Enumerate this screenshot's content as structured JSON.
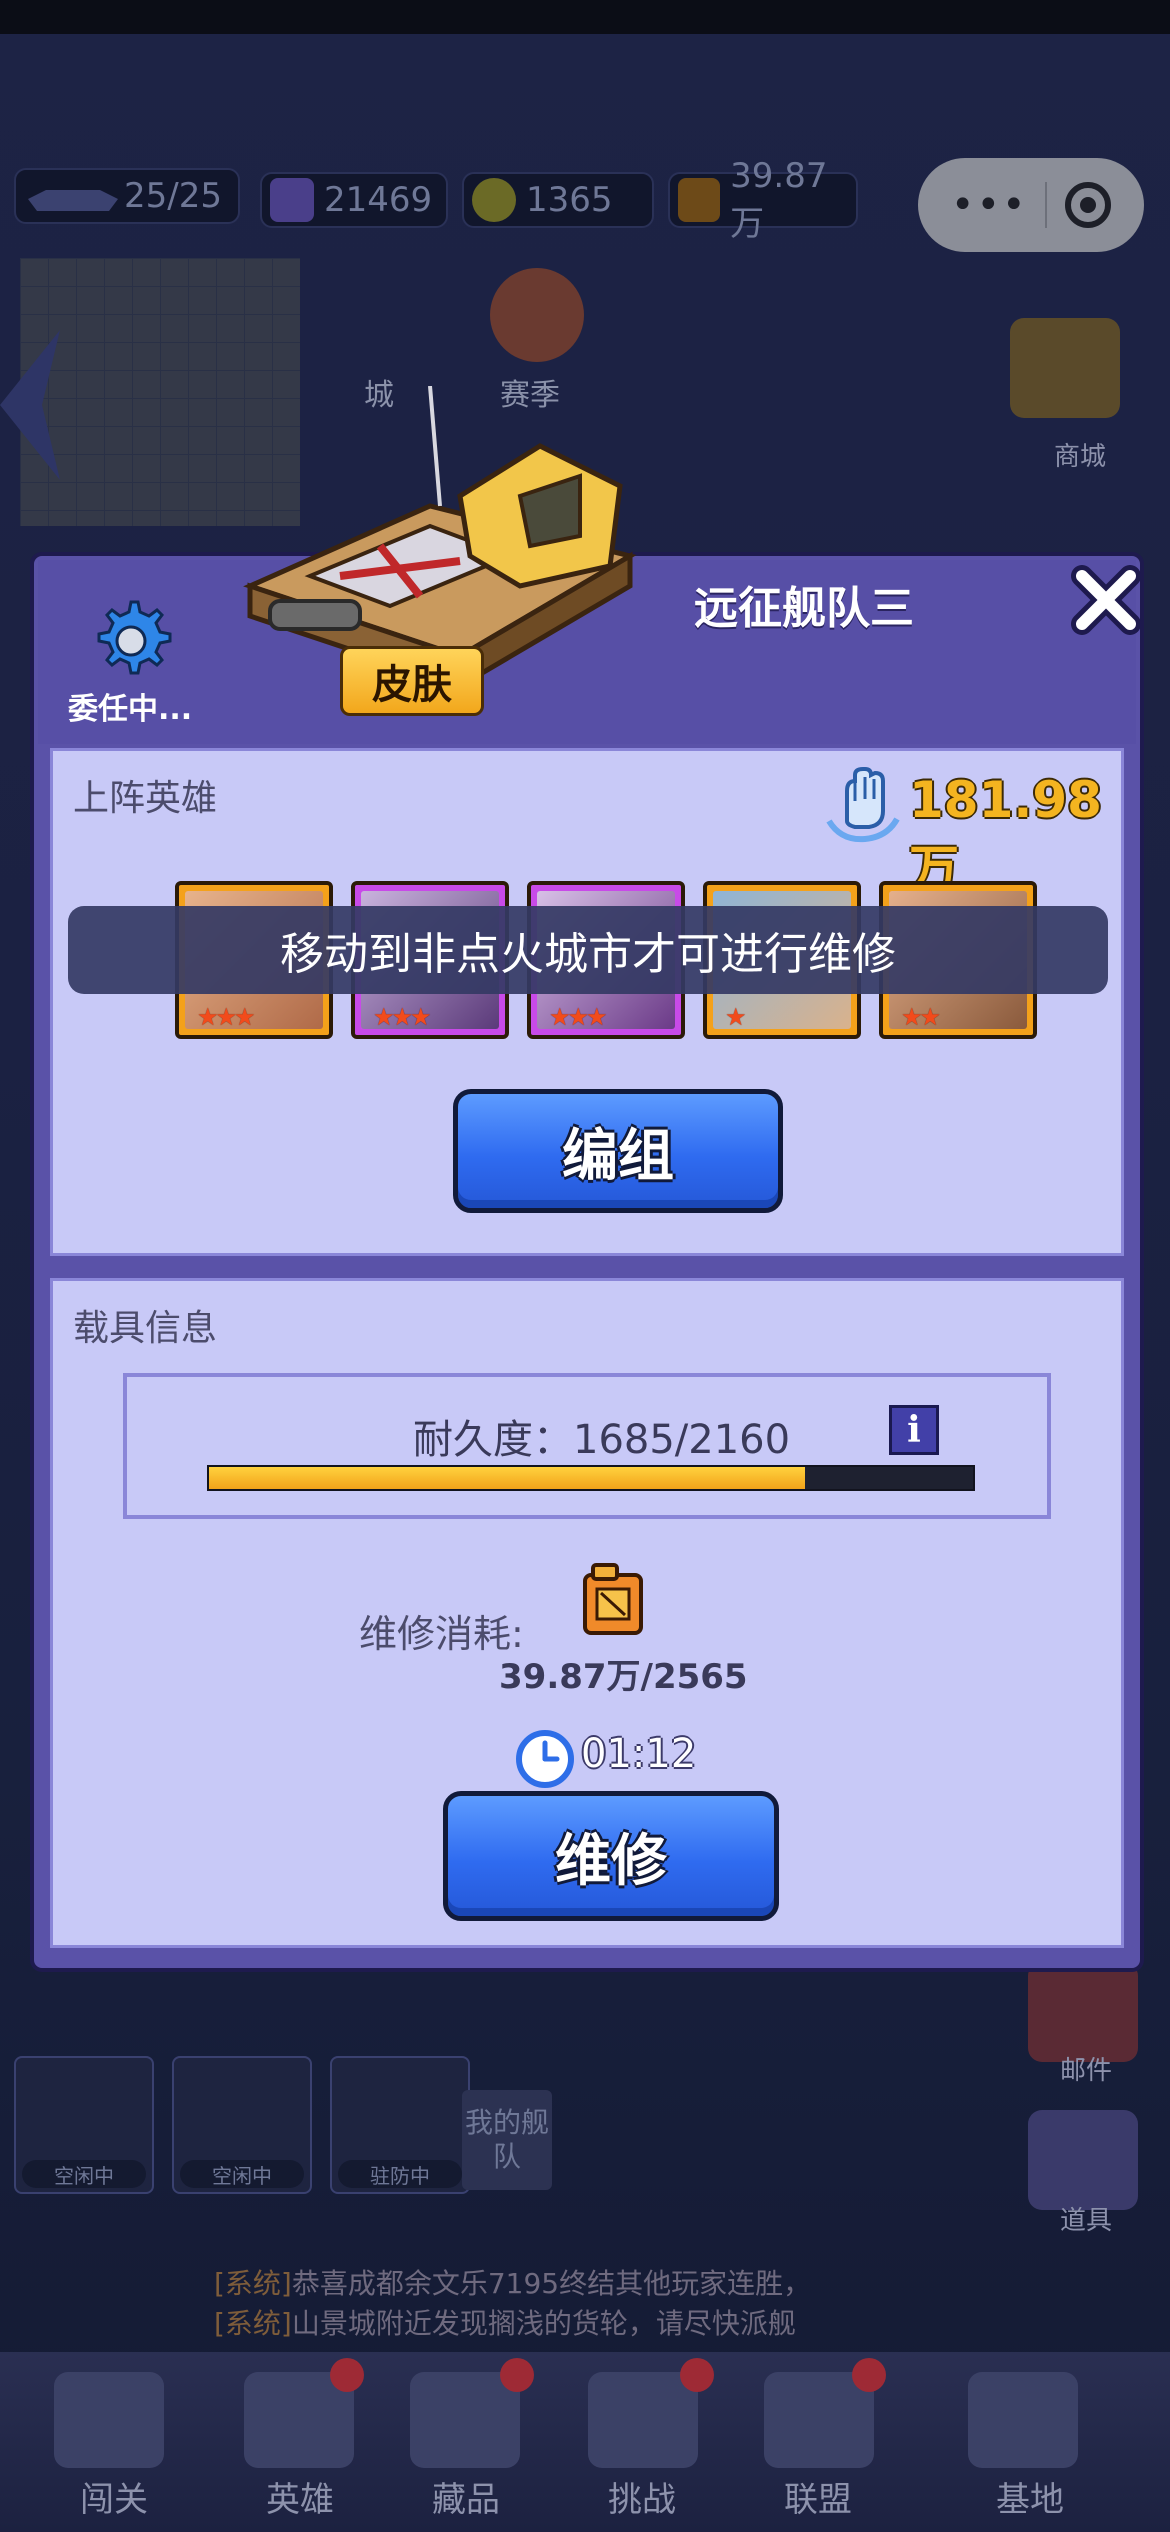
{
  "background": {
    "resources": {
      "fleet": "25/25",
      "currency1": "21469",
      "currency2": "1365",
      "fuel": "39.87万"
    },
    "labels": {
      "city": "城",
      "season": "赛季",
      "shop": "商城",
      "mail": "邮件",
      "items": "道具"
    },
    "squads": [
      {
        "status": "空闲中"
      },
      {
        "status": "空闲中"
      },
      {
        "status": "驻防中"
      }
    ],
    "my_fleet_label": "我的舰队",
    "system_messages": [
      {
        "tag": "[系统]",
        "text": "恭喜成都余文乐7195终结其他玩家连胜，"
      },
      {
        "tag": "[系统]",
        "text": "山景城附近发现搁浅的货轮，请尽快派舰"
      }
    ],
    "nav": [
      "闯关",
      "英雄",
      "藏品",
      "挑战",
      "联盟",
      "基地"
    ]
  },
  "dialog": {
    "title": "远征舰队三",
    "delegate_label": "委任中...",
    "skin_label": "皮肤",
    "heroes_panel": {
      "title": "上阵英雄",
      "power": "181.98万",
      "heroes": [
        {
          "frame": "gold",
          "stars": "★★★"
        },
        {
          "frame": "purple",
          "stars": "★★★"
        },
        {
          "frame": "purple",
          "stars": "★★★"
        },
        {
          "frame": "gold",
          "stars": "★"
        },
        {
          "frame": "gold",
          "stars": "★★"
        }
      ],
      "edit_button": "编组"
    },
    "toast": "移动到非点火城市才可进行维修",
    "vehicle_panel": {
      "title": "载具信息",
      "durability_label": "耐久度：1685/2160",
      "durability_current": 1685,
      "durability_max": 2160,
      "info_icon_text": "i",
      "repair_cost_label": "维修消耗:",
      "repair_cost_value": "39.87万/2565",
      "timer": "01:12",
      "repair_button": "维修"
    }
  },
  "colors": {
    "dialog_bg": "#5a52a8",
    "panel_bg": "#c8c9f7",
    "button_blue": "#2f6bf0",
    "power_gold": "#f4b420",
    "progress_gold": "#f2a21a"
  }
}
